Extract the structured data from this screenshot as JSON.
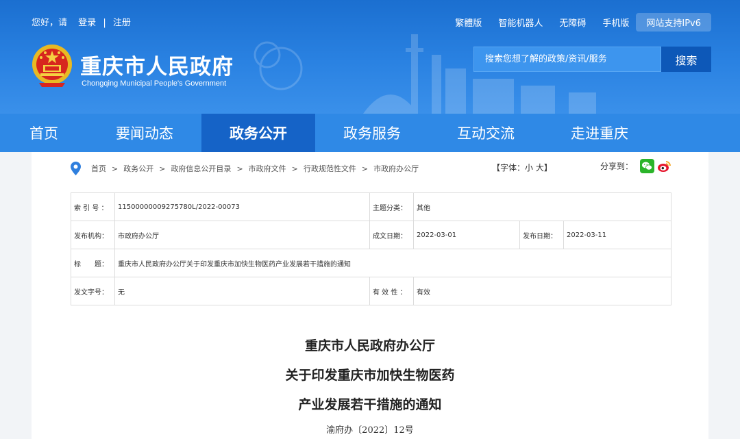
{
  "topbar": {
    "greeting": "您好，请",
    "login": "登录",
    "divider": "|",
    "register": "注册",
    "links": [
      "繁體版",
      "智能机器人",
      "无障碍",
      "手机版"
    ],
    "ipv6": "网站支持IPv6"
  },
  "site": {
    "title": "重庆市人民政府",
    "subtitle": "Chongqing Municipal People's Government"
  },
  "search": {
    "placeholder": "搜索您想了解的政策/资讯/服务",
    "button": "搜索"
  },
  "nav": {
    "items": [
      "首页",
      "要闻动态",
      "政务公开",
      "政务服务",
      "互动交流",
      "走进重庆"
    ],
    "active_index": 2
  },
  "breadcrumb": {
    "items": [
      "首页",
      "政务公开",
      "政府信息公开目录",
      "市政府文件",
      "行政规范性文件",
      "市政府办公厅"
    ],
    "separator": ">"
  },
  "font_size": {
    "prefix": "【字体：",
    "small": "小",
    "large": "大",
    "suffix": "】"
  },
  "share": {
    "label": "分享到："
  },
  "meta": {
    "index_label": "索 引 号 ：",
    "index_value": "11500000009275780L/2022-00073",
    "topic_label": "主题分类：",
    "topic_value": "其他",
    "org_label": "发布机构：",
    "org_value": "市政府办公厅",
    "created_label": "成文日期：",
    "created_value": "2022-03-01",
    "published_label": "发布日期：",
    "published_value": "2022-03-11",
    "title_label": "标　　题：",
    "title_value": "重庆市人民政府办公厅关于印发重庆市加快生物医药产业发展若干措施的通知",
    "docno_label": "发文字号：",
    "docno_value": "无",
    "validity_label": "有 效 性 ：",
    "validity_value": "有效"
  },
  "document": {
    "title_lines": [
      "重庆市人民政府办公厅",
      "关于印发重庆市加快生物医药",
      "产业发展若干措施的通知"
    ],
    "number": "渝府办〔2022〕12号"
  },
  "colors": {
    "header_blue": "#2a82e2",
    "nav_blue": "#2f89e6",
    "nav_active": "#1563c7",
    "search_button": "#0d58b8"
  }
}
